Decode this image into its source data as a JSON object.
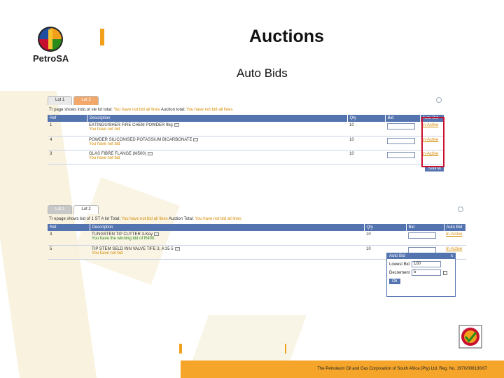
{
  "header": {
    "brand": "PetroSA",
    "title": "Auctions",
    "subtitle": "Auto Bids"
  },
  "panel1": {
    "tabs": [
      "Lot 1",
      "Lot 2"
    ],
    "summary_prefix": "Tr page shows indo.ot sle lot total:",
    "summary_status1": "You have not bid all lines",
    "summary_mid": "Auction total:",
    "summary_status2": "You have not bid all lines",
    "columns": [
      "Ref",
      "Description",
      "Qty",
      "Bid",
      "Auto Bid"
    ],
    "rows": [
      {
        "ref": "1",
        "desc": "EXTINGUISHER FIRE CHEM POWDER 9kg",
        "note": "You have not bid",
        "qty": "10",
        "auto": "In-Active"
      },
      {
        "ref": "4",
        "desc": "POWDER SILICONISED POTASSIUM BICARBONATE",
        "note": "You have not bid",
        "qty": "10",
        "auto": "In-Active"
      },
      {
        "ref": "3",
        "desc": "GLAS FIBRE FLANGE (M500)",
        "note": "You have not bid",
        "qty": "10",
        "auto": "In-Active"
      }
    ],
    "button": "Submit"
  },
  "panel2": {
    "tabs": [
      "Lot 1",
      "Lot 2"
    ],
    "summary_prefix": "Tr epage shows bid of 1 ST A lot Total:",
    "summary_status1": "You have not bid all lines",
    "summary_mid": "Auction Total:",
    "summary_status2": "You have not bid all lines",
    "columns": [
      "Ref",
      "Description",
      "Qty",
      "Bid",
      "Auto Bid"
    ],
    "rows": [
      {
        "ref": "3",
        "desc": "TUNGSTEN TIP CUTTER 3-Key",
        "note": "You have the winning bid of R400.",
        "note_type": "win",
        "qty": "10",
        "auto": "In-Active"
      },
      {
        "ref": "5",
        "desc": "TIP STEM SELD INN VALVE TIFE 3, A 35 5",
        "note": "You have not bid",
        "note_type": "not",
        "qty": "10",
        "auto": "In-Active"
      }
    ]
  },
  "popup": {
    "title": "Auto Bid",
    "close": "x",
    "lowest_label": "Lowest Bid",
    "lowest_value": "100",
    "decrement_label": "Decrement",
    "decrement_value": "5",
    "button": "Ok"
  },
  "footer": {
    "text": "The Petroleum Oil and Gas Corporation of South Africa (Pty) Ltd. Reg. No. 1970/008130/07"
  },
  "colors": {
    "accent": "#f0a01a",
    "table_header": "#5474b0",
    "highlight": "#c8102e",
    "status_orange": "#d58a00",
    "status_green": "#2a8a1a"
  }
}
